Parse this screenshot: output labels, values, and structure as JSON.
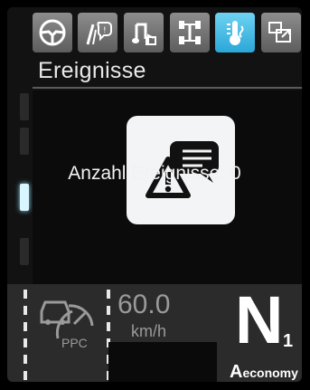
{
  "header": {
    "tabs": [
      {
        "icon": "steering-wheel-icon",
        "active": false
      },
      {
        "icon": "driver-assist-icon",
        "active": false
      },
      {
        "icon": "music-note-icon",
        "active": false
      },
      {
        "icon": "vehicle-axle-icon",
        "active": false
      },
      {
        "icon": "temperature-icon",
        "active": true
      },
      {
        "icon": "settings-export-icon",
        "active": false
      }
    ]
  },
  "section": {
    "title": "Ereignisse"
  },
  "main": {
    "icon": "event-warning-message-icon",
    "count_label": "Anzahl Ereignisse: 0"
  },
  "status": {
    "ppc_label": "PPC",
    "speed_value": "60.0",
    "speed_unit": "km/h",
    "gear_letter": "N",
    "gear_number": "1",
    "mode_prefix": "A",
    "mode_suffix": "economy"
  },
  "colors": {
    "active_tab": "#2aa7d8",
    "inactive_tab": "#6f6f6f",
    "background": "#121212",
    "scroll_active": "#d9f6ff"
  }
}
